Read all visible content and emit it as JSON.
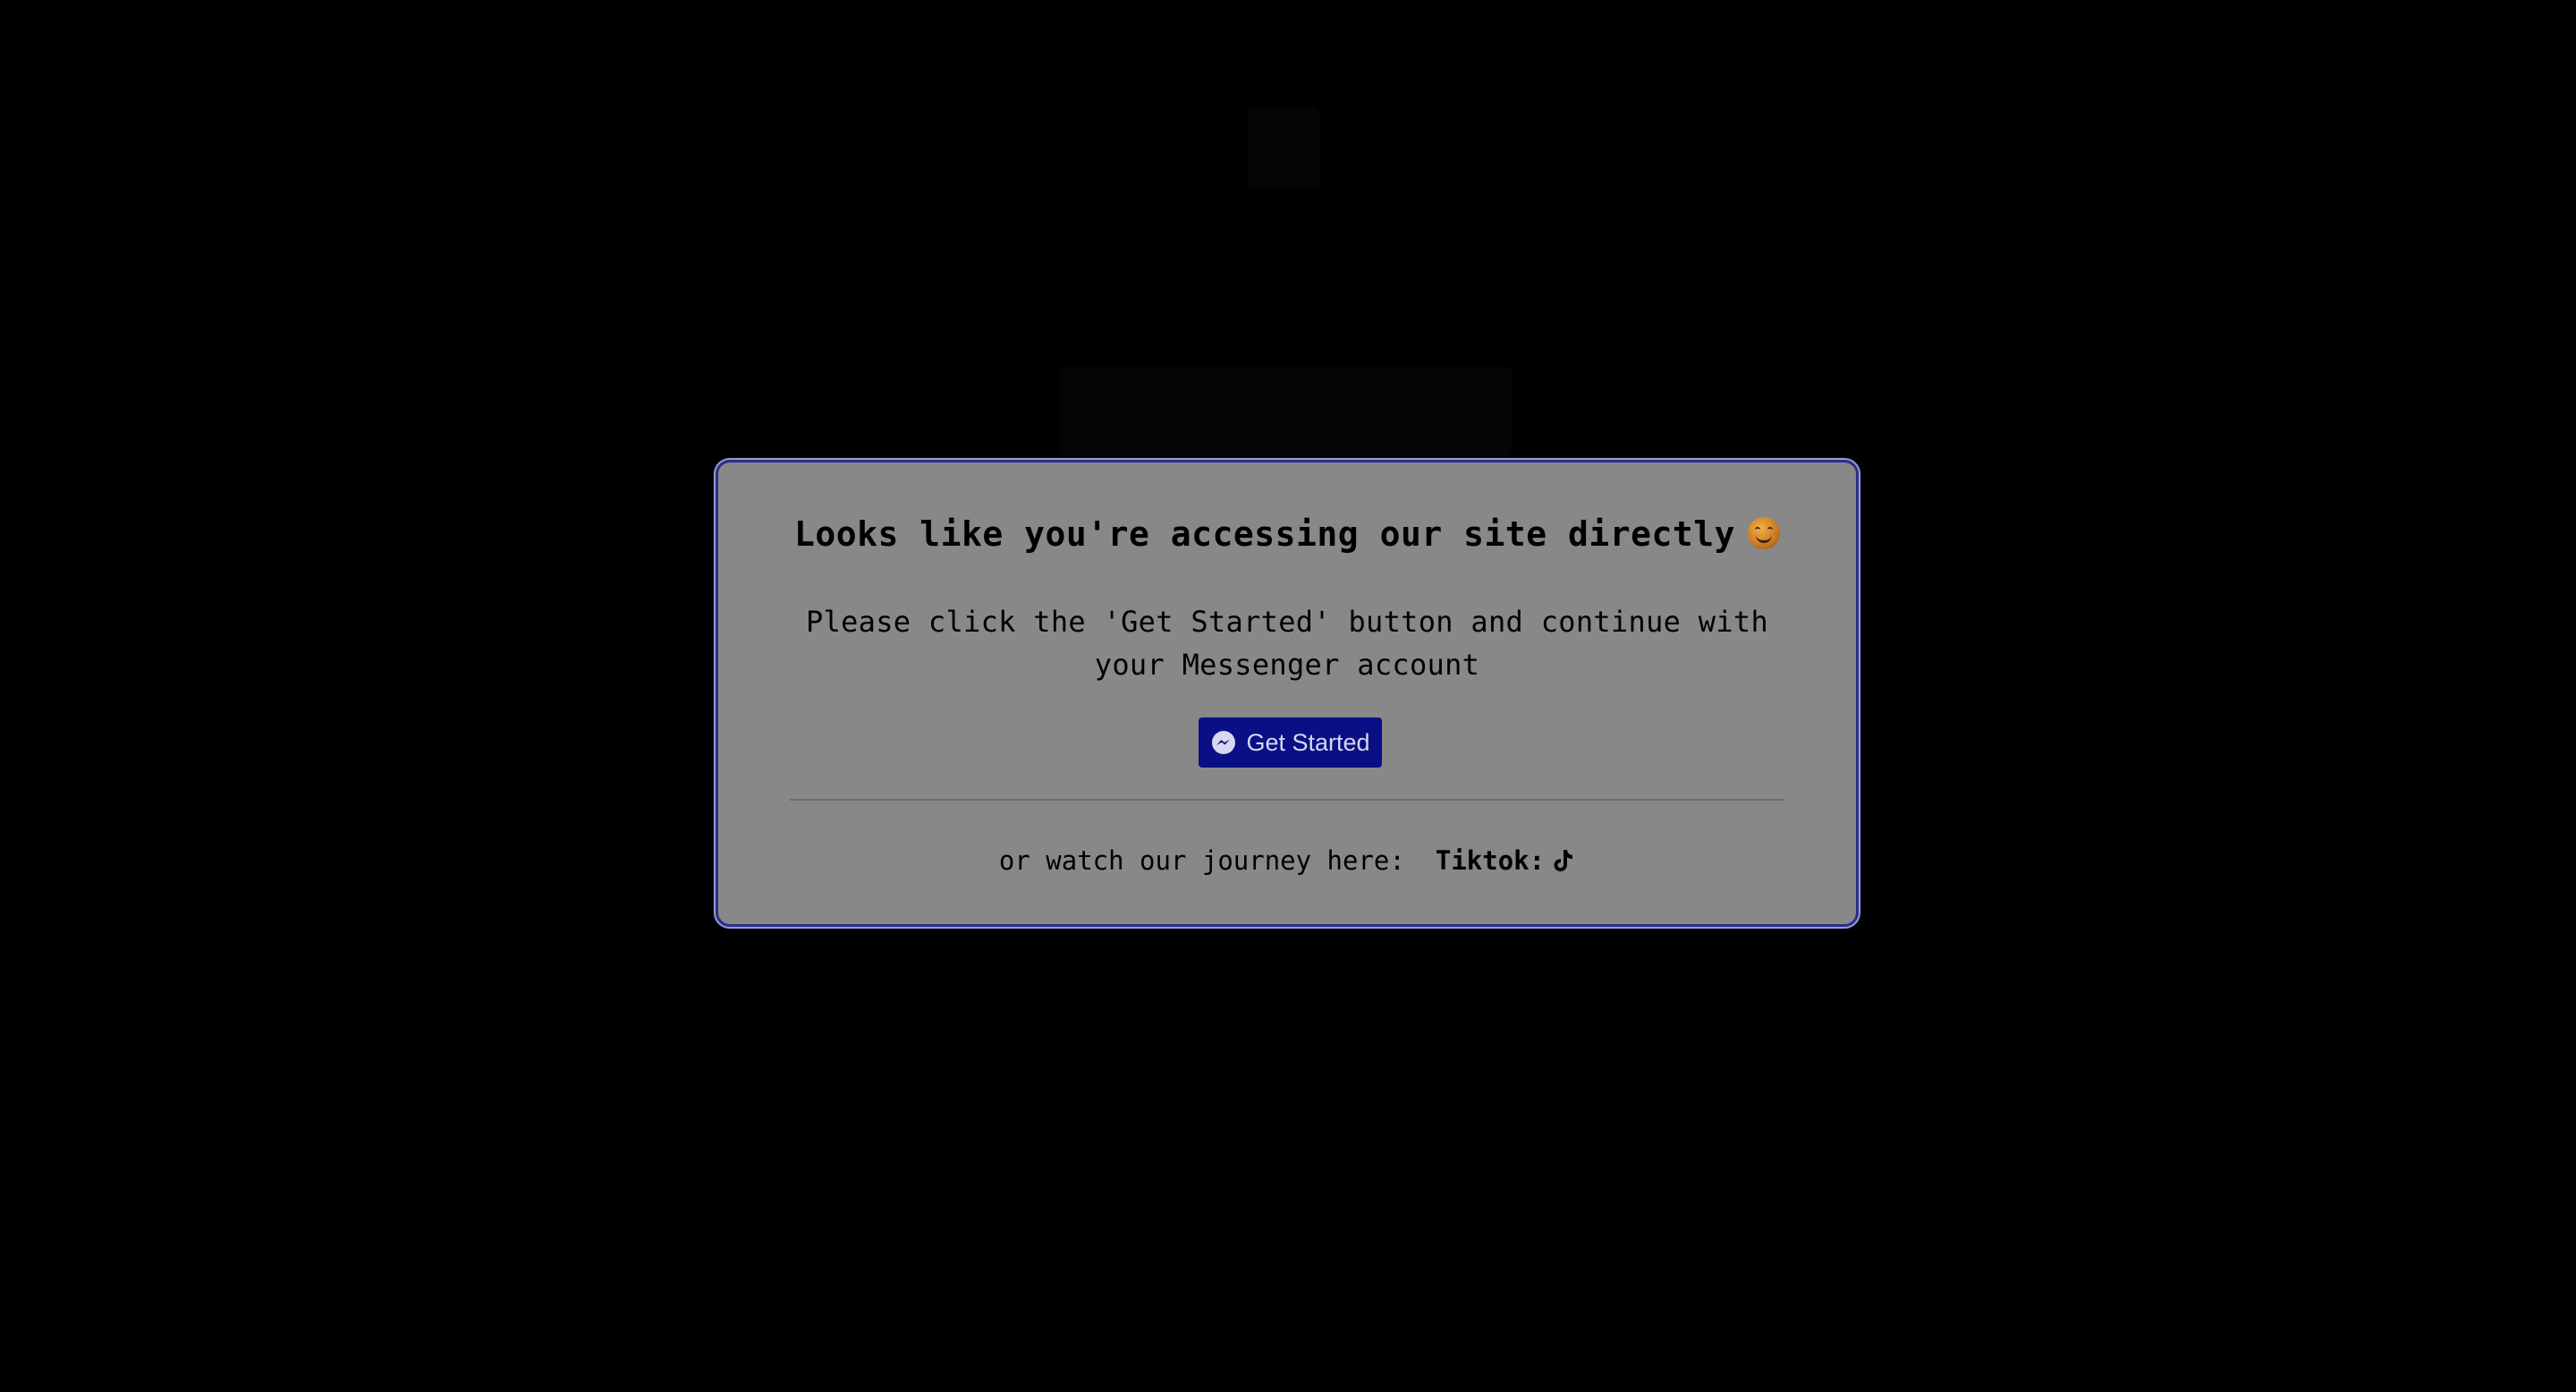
{
  "modal": {
    "title": "Looks like you're accessing our site directly",
    "title_emoji": "smiling-face-emoji",
    "message": "Please click the 'Get Started' button and continue with your Messenger account",
    "button_label": "Get Started",
    "button_icon": "messenger-icon",
    "footer_text": "or watch our journey here:",
    "tiktok_label": "Tiktok:",
    "tiktok_icon": "tiktok-icon"
  },
  "colors": {
    "page_background": "#000000",
    "modal_background": "#888888",
    "modal_border": "#2a2f8a",
    "button_background": "#0a0f86",
    "button_text": "#d6d8ee"
  }
}
